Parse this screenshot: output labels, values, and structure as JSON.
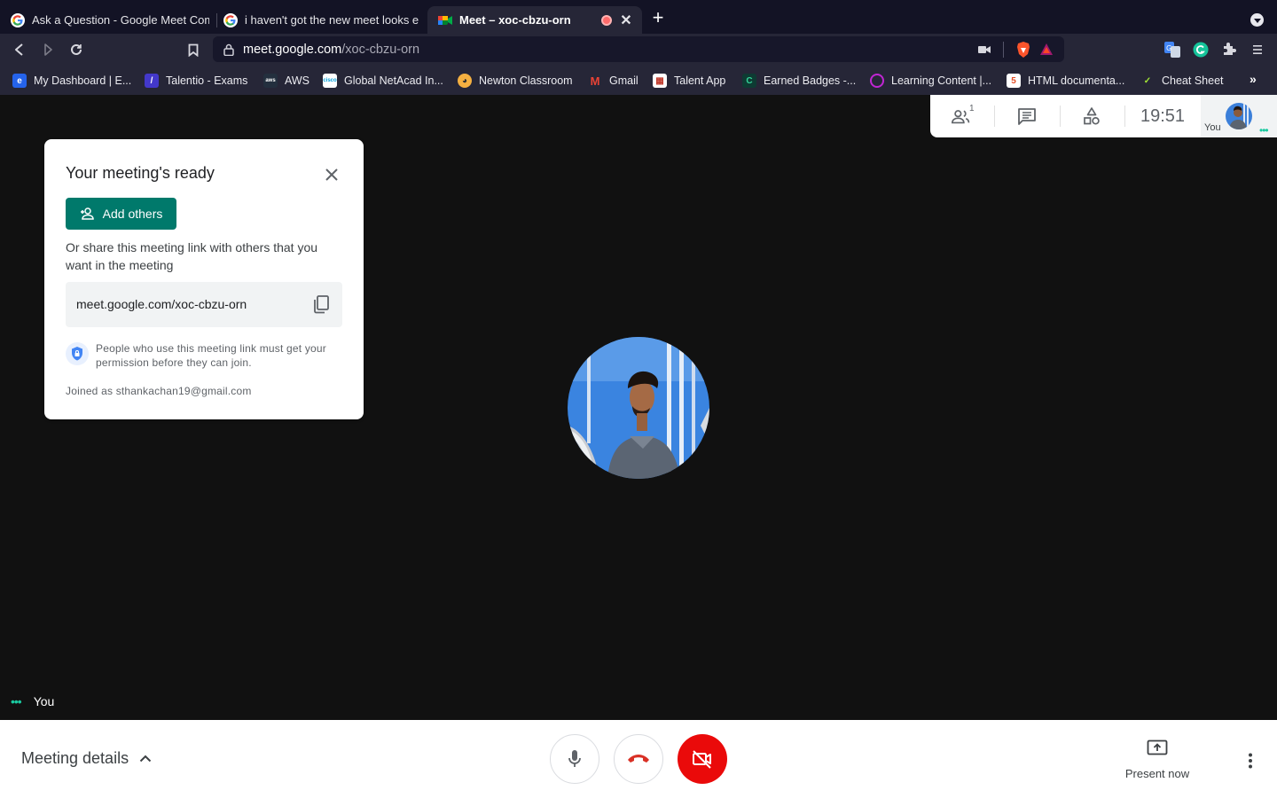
{
  "browser": {
    "tabs": [
      {
        "title": "Ask a Question - Google Meet Comm",
        "icon": "google-icon"
      },
      {
        "title": "i haven't got the new meet looks ev",
        "icon": "google-icon"
      },
      {
        "title": "Meet – xoc-cbzu-orn",
        "icon": "meet-icon",
        "active": true,
        "recording": true
      }
    ],
    "url_host": "meet.google.com",
    "url_path": "/xoc-cbzu-orn",
    "bookmarks": [
      "My Dashboard | E...",
      "Talentio - Exams",
      "AWS",
      "Global NetAcad In...",
      "Newton Classroom",
      "Gmail",
      "Talent App",
      "Earned Badges -...",
      "Learning Content |...",
      "HTML documenta...",
      "Cheat Sheet"
    ]
  },
  "top_panel": {
    "participants_count": "1",
    "time": "19:51",
    "self_label": "You"
  },
  "ready_card": {
    "title": "Your meeting's ready",
    "add_button": "Add others",
    "share_text": "Or share this meeting link with others that you want in the meeting",
    "link": "meet.google.com/xoc-cbzu-orn",
    "permission_text": "People who use this meeting link must get your permission before they can join.",
    "joined_as": "Joined as sthankachan19@gmail.com"
  },
  "tile": {
    "name": "You"
  },
  "bottom_bar": {
    "meeting_details": "Meeting details",
    "present_now": "Present now"
  },
  "colors": {
    "accent": "#00796b",
    "end_call": "#ea0a0a",
    "speaking": "#1ac9a0"
  }
}
